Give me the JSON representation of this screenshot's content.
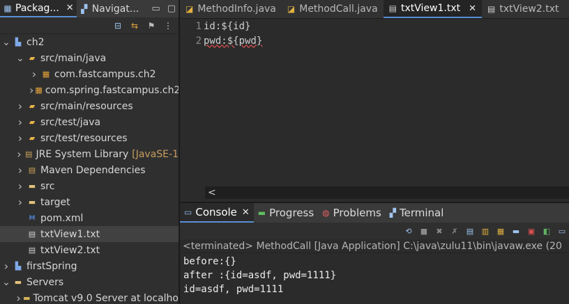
{
  "left_panel": {
    "tabs": [
      {
        "label": "Packag...",
        "active": true
      },
      {
        "label": "Navigat...",
        "active": false
      }
    ],
    "tree": [
      {
        "label": "ch2",
        "depth": 0,
        "expanded": true,
        "icon": "maven-project-icon"
      },
      {
        "label": "src/main/java",
        "depth": 1,
        "expanded": true,
        "icon": "source-folder-icon"
      },
      {
        "label": "com.fastcampus.ch2",
        "depth": 2,
        "expanded": false,
        "icon": "package-icon"
      },
      {
        "label": "com.spring.fastcampus.ch2",
        "depth": 2,
        "expanded": false,
        "icon": "package-icon"
      },
      {
        "label": "src/main/resources",
        "depth": 1,
        "expanded": false,
        "icon": "source-folder-icon"
      },
      {
        "label": "src/test/java",
        "depth": 1,
        "expanded": false,
        "icon": "source-folder-icon"
      },
      {
        "label": "src/test/resources",
        "depth": 1,
        "expanded": false,
        "icon": "source-folder-icon"
      },
      {
        "label": "JRE System Library",
        "suffix": "[JavaSE-1",
        "depth": 1,
        "expanded": false,
        "icon": "library-icon"
      },
      {
        "label": "Maven Dependencies",
        "depth": 1,
        "expanded": false,
        "icon": "library-icon"
      },
      {
        "label": "src",
        "depth": 1,
        "expanded": false,
        "icon": "folder-icon"
      },
      {
        "label": "target",
        "depth": 1,
        "expanded": false,
        "icon": "folder-icon"
      },
      {
        "label": "pom.xml",
        "depth": 1,
        "leaf": true,
        "icon": "maven-xml-icon"
      },
      {
        "label": "txtView1.txt",
        "depth": 1,
        "leaf": true,
        "selected": true,
        "icon": "text-file-icon"
      },
      {
        "label": "txtView2.txt",
        "depth": 1,
        "leaf": true,
        "icon": "text-file-icon"
      },
      {
        "label": "firstSpring",
        "depth": 0,
        "expanded": false,
        "icon": "maven-project-icon"
      },
      {
        "label": "Servers",
        "depth": 0,
        "expanded": true,
        "icon": "folder-icon"
      },
      {
        "label": "Tomcat v9.0 Server at localho",
        "depth": 1,
        "expanded": false,
        "icon": "server-folder-icon"
      }
    ]
  },
  "editor": {
    "tabs": [
      {
        "label": "MethodInfo.java",
        "active": false,
        "icon": "java-file-icon"
      },
      {
        "label": "MethodCall.java",
        "active": false,
        "icon": "java-file-icon"
      },
      {
        "label": "txtView1.txt",
        "active": true,
        "icon": "text-file-icon"
      },
      {
        "label": "txtView2.txt",
        "active": false,
        "icon": "text-file-icon"
      }
    ],
    "lines": [
      {
        "num": "1",
        "text": "id:${id}"
      },
      {
        "num": "2",
        "text": "pwd:${pwd}"
      }
    ],
    "hscroll_arrow": "<"
  },
  "console": {
    "tabs": [
      {
        "label": "Console",
        "active": true,
        "icon": "console-icon"
      },
      {
        "label": "Progress",
        "active": false,
        "icon": "progress-icon"
      },
      {
        "label": "Problems",
        "active": false,
        "icon": "problems-icon"
      },
      {
        "label": "Terminal",
        "active": false,
        "icon": "terminal-icon"
      }
    ],
    "status": "<terminated> MethodCall [Java Application] C:\\java\\zulu11\\bin\\javaw.exe  (20",
    "output": [
      "before:{}",
      "after :{id=asdf, pwd=1111}",
      "id=asdf, pwd=1111"
    ]
  },
  "colors": {
    "background": "#2b2b2b",
    "active_tab_underline": "#5a8fd6",
    "selection": "#414141"
  }
}
